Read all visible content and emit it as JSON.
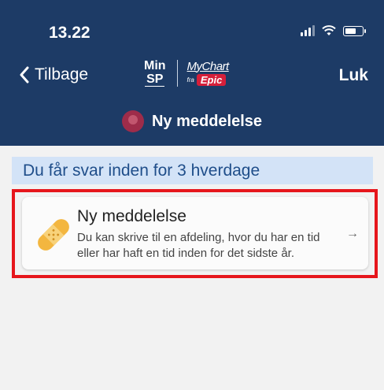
{
  "status_bar": {
    "time": "13.22"
  },
  "header": {
    "back_label": "Tilbage",
    "logo_minsp_top": "Min",
    "logo_minsp_bottom": "SP",
    "logo_mychart": "MyChart",
    "logo_fra": "fra",
    "logo_epic": "Epic",
    "close_label": "Luk",
    "page_title": "Ny meddelelse"
  },
  "banner": {
    "text": "Du får svar inden for 3 hverdage"
  },
  "card": {
    "title": "Ny meddelelse",
    "description": "Du kan skrive til en afdeling, hvor du har en tid eller har haft en tid inden for det sidste år.",
    "arrow": "→"
  },
  "colors": {
    "header_bg": "#1d3b66",
    "banner_bg": "#d3e3f7",
    "highlight": "#e6161c",
    "epic_red": "#d61f3a"
  }
}
